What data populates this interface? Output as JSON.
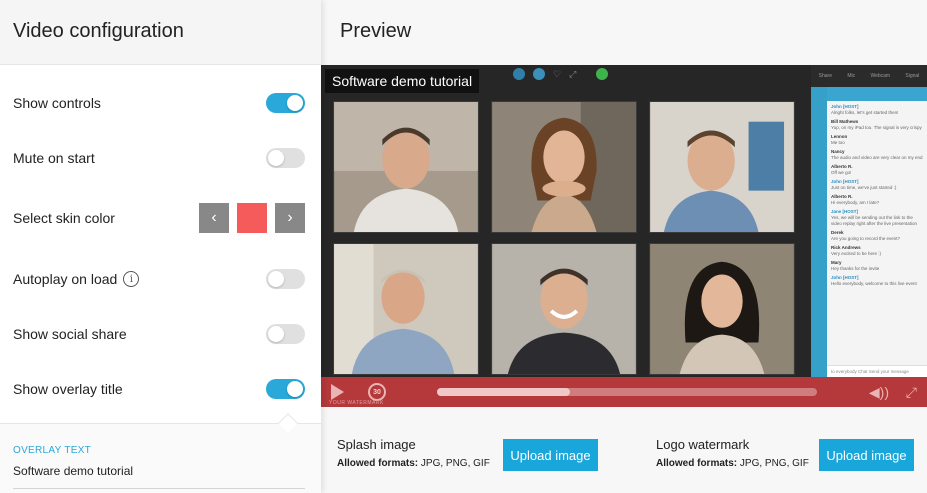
{
  "left": {
    "title": "Video configuration",
    "settings": {
      "show_controls": {
        "label": "Show controls",
        "enabled": true
      },
      "mute_on_start": {
        "label": "Mute on start",
        "enabled": false
      },
      "skin_color": {
        "label": "Select skin color",
        "value": "#f55b5b",
        "prev_icon": "chevron-left-icon",
        "next_icon": "chevron-right-icon"
      },
      "autoplay_on_load": {
        "label": "Autoplay on load",
        "info_icon": "info-icon",
        "info_glyph": "i",
        "enabled": false
      },
      "show_social_share": {
        "label": "Show social share",
        "enabled": false
      },
      "show_overlay_title": {
        "label": "Show overlay title",
        "enabled": true
      }
    },
    "overlay_text": {
      "label": "OVERLAY TEXT",
      "value": "Software demo tutorial"
    }
  },
  "right": {
    "title": "Preview",
    "video": {
      "overlay_title": "Software demo tutorial",
      "skip_label": "30",
      "progress": 0.35,
      "watermark": "YOUR WATERMARK",
      "chat_tabs": [
        "Share",
        "Mic",
        "Webcam",
        "Signal"
      ],
      "chat_messages": [
        {
          "who": "John [HOST]",
          "text": "Alright folks, let's get started then!",
          "host": true
        },
        {
          "who": "Bill Mathews",
          "text": "Yup, on my iPad too. The signal is very crispy",
          "host": false
        },
        {
          "who": "Lennon",
          "text": "Me too",
          "host": false
        },
        {
          "who": "Nancy",
          "text": "The audio and video are very clear on my end",
          "host": false
        },
        {
          "who": "Alberto R.",
          "text": "Off we go!",
          "host": false
        },
        {
          "who": "John [HOST]",
          "text": "Just on time, we've just started :)",
          "host": true
        },
        {
          "who": "Alberto R.",
          "text": "Hi everybody, am I late?",
          "host": false
        },
        {
          "who": "Jane [HOST]",
          "text": "Yes, we will be sending out the link to the video replay right after the live presentation",
          "host": true
        },
        {
          "who": "Derek",
          "text": "Are you going to record the event?",
          "host": false
        },
        {
          "who": "Rick Andrews",
          "text": "Very excited to be here :)",
          "host": false
        },
        {
          "who": "Mary",
          "text": "Hey thanks for the invite",
          "host": false
        },
        {
          "who": "John [HOST]",
          "text": "Hello everybody, welcome to this live event",
          "host": true
        }
      ],
      "chat_recipient": "to everybody",
      "chat_mode": "Chat",
      "chat_placeholder": "Send your message"
    },
    "splash": {
      "title": "Splash image",
      "formats_label": "Allowed formats:",
      "formats": "JPG, PNG, GIF",
      "button": "Upload image"
    },
    "logo": {
      "title": "Logo watermark",
      "formats_label": "Allowed formats:",
      "formats": "JPG, PNG, GIF",
      "button": "Upload image"
    }
  },
  "colors": {
    "accent": "#29a8d9",
    "button": "#19a6db",
    "skin": "#f55b5b",
    "controlbar": "#b5383b"
  }
}
